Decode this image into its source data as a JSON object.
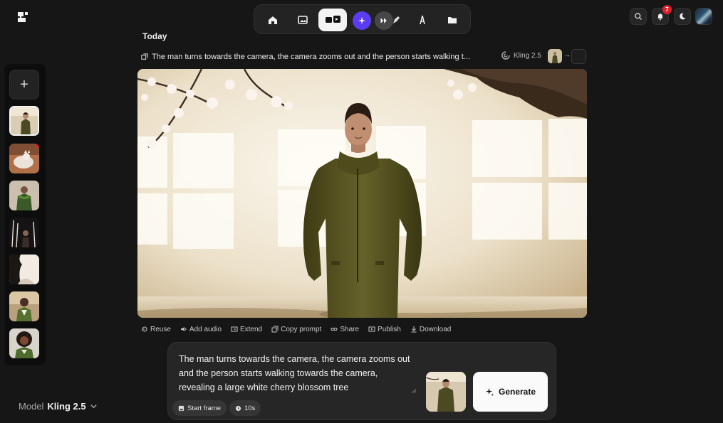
{
  "icons": {
    "logo": "brand-logo-icon",
    "nav": [
      "home-icon",
      "image-icon",
      "video-icon",
      "ai-sparkle-icon",
      "motion-icon",
      "pen-icon",
      "text-icon",
      "folder-icon"
    ],
    "top_right": [
      "search-icon",
      "bell-icon",
      "moon-icon",
      "profile-avatar"
    ]
  },
  "notifications": {
    "count": "7"
  },
  "rail": {
    "add_label": "+"
  },
  "feed": {
    "section_title": "Today",
    "prompt_preview": "The man turns towards the camera, the camera zooms out and the person starts walking t...",
    "model_badge": "Kling 2.5",
    "arrow": "→"
  },
  "actions": {
    "reuse": "Reuse",
    "add_audio": "Add audio",
    "extend": "Extend",
    "copy_prompt": "Copy prompt",
    "share": "Share",
    "publish": "Publish",
    "download": "Download"
  },
  "composer": {
    "prompt_text": "The man turns towards the camera, the camera zooms out and the person starts walking towards the camera, revealing a large white cherry blossom tree",
    "generate_label": "Generate",
    "start_frame_label": "Start frame",
    "duration_label": "10s"
  },
  "model_selector": {
    "label": "Model",
    "value": "Kling 2.5"
  },
  "colors": {
    "background": "#161616",
    "accent_purple": "#5b3cf2",
    "badge_red": "#e0202e",
    "generate_bg": "#fafafa"
  }
}
